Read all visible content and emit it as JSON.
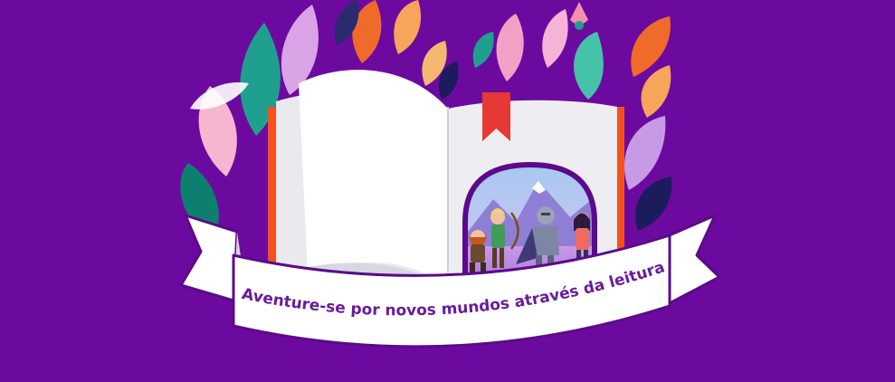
{
  "banner": {
    "tagline": "Aventure-se por novos mundos através da leitura"
  },
  "colors": {
    "background": "#6c0aa0",
    "ribbon": "#ffffff",
    "ribbon_outline": "#5b0a8a",
    "tagline_text": "#6a1b9a",
    "bookmark": "#e53935",
    "book_edge": "#f4511e"
  },
  "icons": [
    "book-illustration",
    "bookmark-icon",
    "leaf-icon",
    "flower-bud-icon",
    "adventurers-illustration"
  ]
}
